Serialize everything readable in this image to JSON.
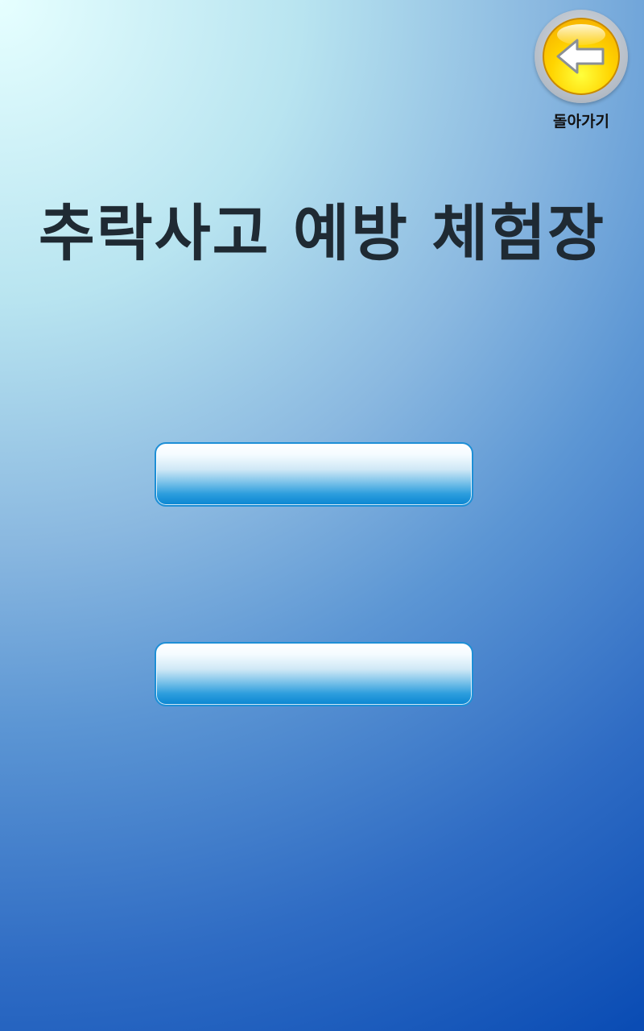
{
  "header": {
    "back_label": "돌아가기",
    "back_icon": "left-arrow-icon"
  },
  "title": "추락사고 예방 체험장",
  "menu": {
    "buttons": [
      {
        "label": ""
      },
      {
        "label": ""
      }
    ]
  },
  "colors": {
    "title_text": "#1f2a33",
    "button_border": "#1e8fd6",
    "back_button_fill": "#ffd400",
    "background_top_left": "#e6ffff",
    "background_bottom_right": "#0a4cb4"
  }
}
